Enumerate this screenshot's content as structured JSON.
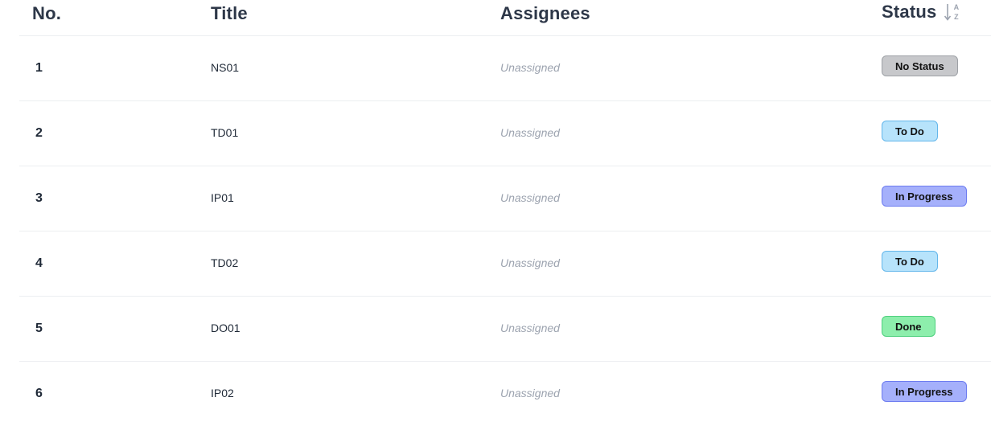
{
  "header": {
    "no": "No.",
    "title": "Title",
    "assignees": "Assignees",
    "status": "Status",
    "sort_icon": "sort-alpha-ascending-icon"
  },
  "status_colors": {
    "No Status": {
      "bg": "#c7c8cb",
      "border": "#9ea1a6"
    },
    "To Do": {
      "bg": "#b7e3fb",
      "border": "#63b6ea"
    },
    "In Progress": {
      "bg": "#a5b0fb",
      "border": "#6d7cf0"
    },
    "Done": {
      "bg": "#8deeac",
      "border": "#4fd07e"
    }
  },
  "rows": [
    {
      "no": "1",
      "title": "NS01",
      "assignee": "Unassigned",
      "status": "No Status"
    },
    {
      "no": "2",
      "title": "TD01",
      "assignee": "Unassigned",
      "status": "To Do"
    },
    {
      "no": "3",
      "title": "IP01",
      "assignee": "Unassigned",
      "status": "In Progress"
    },
    {
      "no": "4",
      "title": "TD02",
      "assignee": "Unassigned",
      "status": "To Do"
    },
    {
      "no": "5",
      "title": "DO01",
      "assignee": "Unassigned",
      "status": "Done"
    },
    {
      "no": "6",
      "title": "IP02",
      "assignee": "Unassigned",
      "status": "In Progress"
    }
  ]
}
